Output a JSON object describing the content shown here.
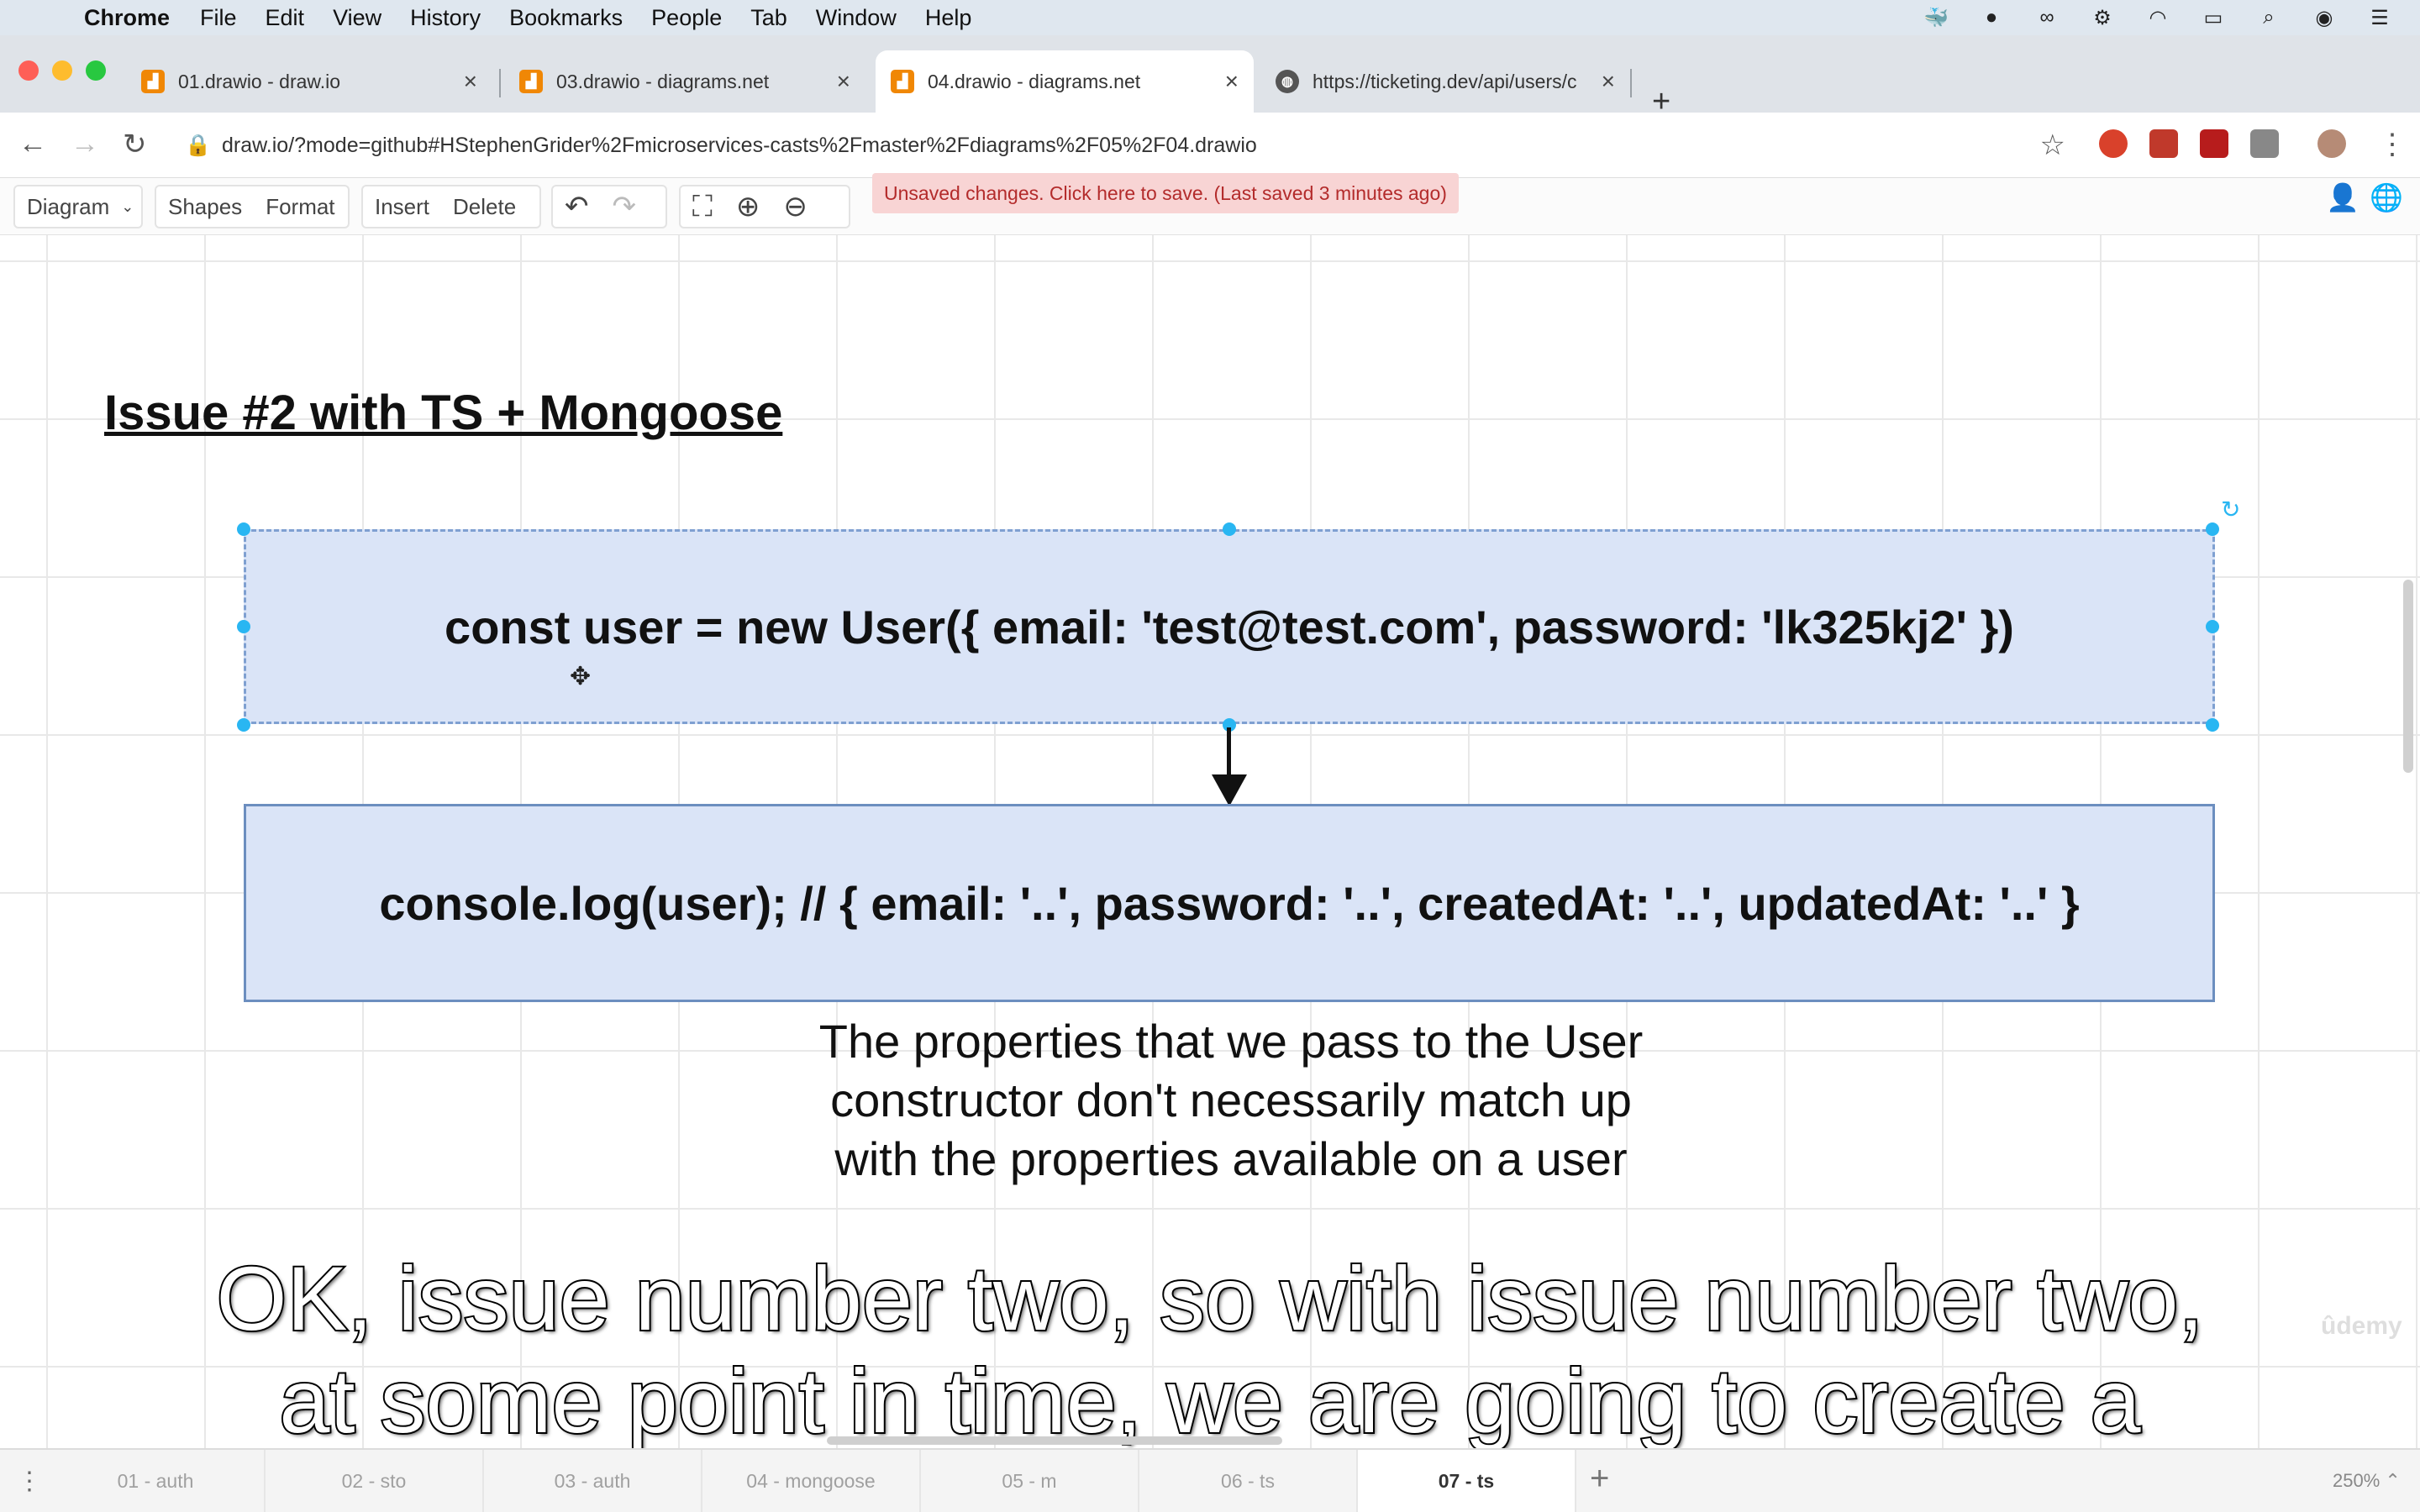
{
  "menubar": {
    "app_name": "Chrome",
    "items": [
      "File",
      "Edit",
      "View",
      "History",
      "Bookmarks",
      "People",
      "Tab",
      "Window",
      "Help"
    ]
  },
  "tabs": [
    {
      "title": "01.drawio - draw.io",
      "icon": "drawio-icon",
      "active": false
    },
    {
      "title": "03.drawio - diagrams.net",
      "icon": "drawio-icon",
      "active": false
    },
    {
      "title": "04.drawio - diagrams.net",
      "icon": "drawio-icon",
      "active": true
    },
    {
      "title": "https://ticketing.dev/api/users/c",
      "icon": "globe-icon",
      "active": false
    }
  ],
  "address": {
    "url": "draw.io/?mode=github#HStephenGrider%2Fmicroservices-casts%2Fmaster%2Fdiagrams%2F05%2F04.drawio"
  },
  "drawio_toolbar": {
    "diagram_label": "Diagram",
    "shapes_label": "Shapes",
    "format_label": "Format",
    "insert_label": "Insert",
    "delete_label": "Delete",
    "save_notice": "Unsaved changes. Click here to save. (Last saved 3 minutes ago)"
  },
  "canvas": {
    "heading": "Issue #2 with TS + Mongoose",
    "box1_text": "const user = new User({ email: 'test@test.com', password: 'lk325kj2' })",
    "box2_text": "console.log(user); // { email: '..', password: '..', createdAt: '..', updatedAt: '..' }",
    "note_lines": [
      "The properties that we pass to the User",
      "constructor don't necessarily match up",
      "with the properties available on a user"
    ]
  },
  "caption": {
    "line1": "OK, issue number two, so with issue number two,",
    "line2": "at some point in time, we are going to create a"
  },
  "watermark": "ûdemy",
  "pages": {
    "tabs": [
      "01 - auth",
      "02 - sto",
      "03 - auth",
      "04 - mongoose",
      "05 - m",
      "06 - ts",
      "07 - ts"
    ],
    "active": "07 - ts",
    "zoom": "250%"
  },
  "colors": {
    "box_fill": "#dae4f7",
    "box_stroke": "#6c8ebf",
    "selection_handle": "#29b6f2",
    "save_notice_bg": "#f8d4d4",
    "save_notice_text": "#b32b2b"
  }
}
